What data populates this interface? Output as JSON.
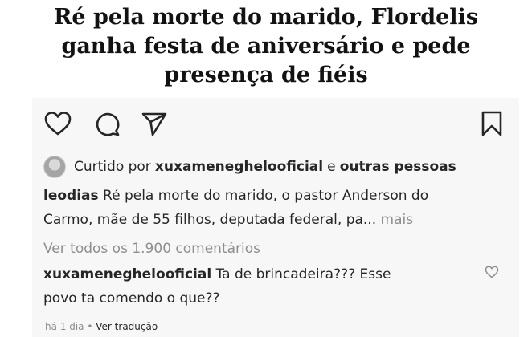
{
  "headline": {
    "line1": "Ré pela morte do marido, Flordelis",
    "line2": "ganha festa de aniversário e pede",
    "line3": "presença de fiéis"
  },
  "post": {
    "icons": {
      "like": "heart-icon",
      "comment": "comment-icon",
      "share": "paper-plane-icon",
      "save": "bookmark-icon"
    },
    "liked_by": {
      "prefix": "Curtido por",
      "user": "xuxameneghelooficial",
      "connector": "e",
      "others": "outras pessoas"
    },
    "caption": {
      "username": "leodias",
      "line1": "Ré pela morte do marido, o pastor Anderson do",
      "line2": "Carmo, mãe de 55 filhos, deputada federal, pa...",
      "more": "mais"
    },
    "view_all_comments": "Ver todos os 1.900 comentários",
    "comment": {
      "username": "xuxameneghelooficial",
      "line1": "Ta de brincadeira??? Esse",
      "line2": "povo ta comendo o que??"
    },
    "meta": {
      "time": "há 1 dia",
      "separator": "•",
      "translate": "Ver tradução"
    }
  }
}
